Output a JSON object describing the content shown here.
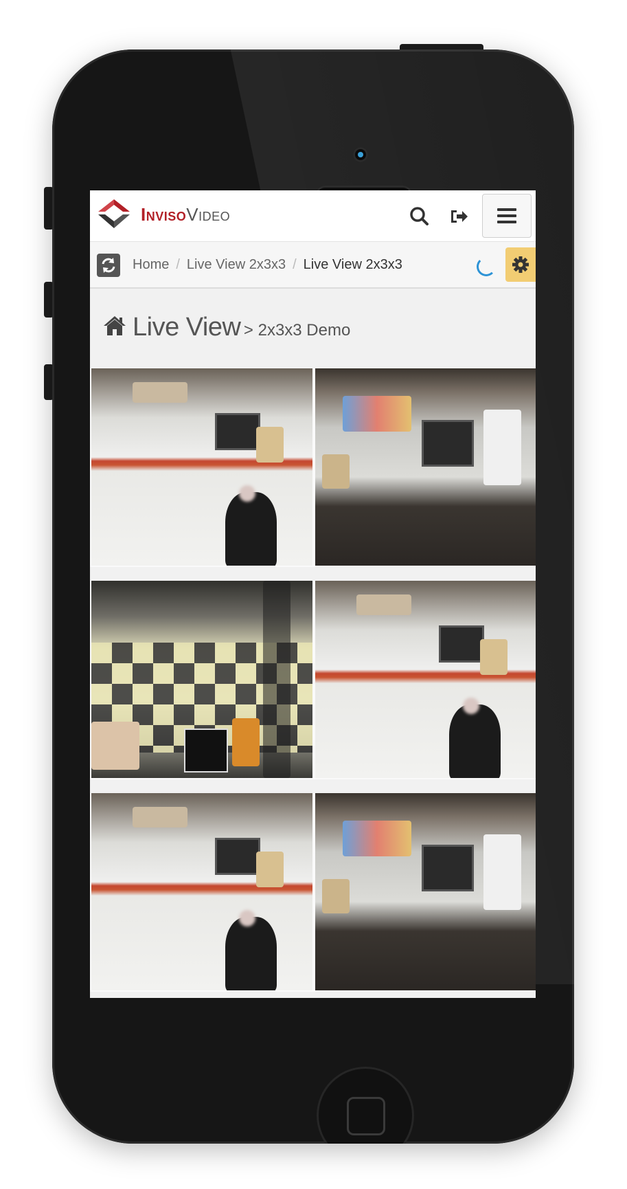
{
  "app": {
    "brand_primary": "Inviso",
    "brand_secondary": "Video",
    "accent_color": "#b22027",
    "settings_color": "#f2cd73",
    "spinner_color": "#2d93d6"
  },
  "header": {
    "icons": [
      "search-icon",
      "sign-out-icon",
      "menu-icon"
    ]
  },
  "breadcrumb": {
    "items": [
      "Home",
      "Live View 2x3x3",
      "Live View 2x3x3"
    ],
    "separator": "/"
  },
  "page": {
    "title": "Live View",
    "subtitle": "> 2x3x3 Demo",
    "title_icon": "home-icon"
  },
  "cameras": {
    "layout": "2x3",
    "count": 6
  }
}
